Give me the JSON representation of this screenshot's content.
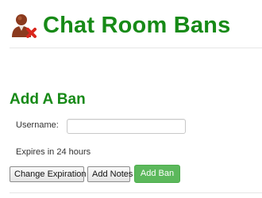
{
  "header": {
    "title": "Chat Room Bans",
    "icon": "user-ban-icon"
  },
  "section": {
    "title": "Add A Ban"
  },
  "form": {
    "username_label": "Username:",
    "username_value": "",
    "expiry_text": "Expires in 24 hours"
  },
  "buttons": {
    "change_expiration": "Change Expiration",
    "add_notes": "Add Notes",
    "add_ban": "Add Ban"
  },
  "colors": {
    "title_green": "#178a17",
    "add_button_green": "#5cb85c",
    "ban_red": "#d9261c",
    "user_brown": "#8b3a1e"
  }
}
